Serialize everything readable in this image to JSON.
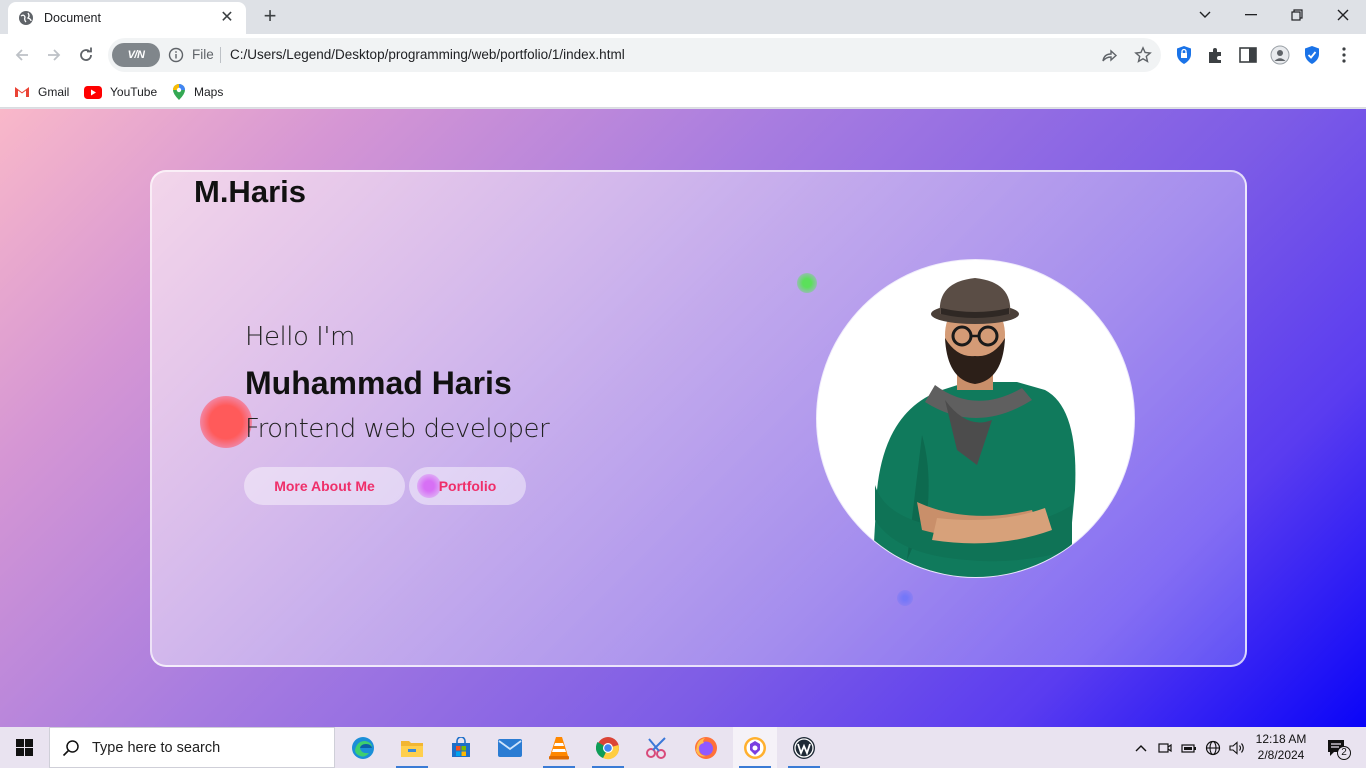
{
  "browser": {
    "tab_title": "Document",
    "close_glyph": "✕",
    "new_tab_glyph": "+",
    "address_prefix": "File",
    "url": "C:/Users/Legend/Desktop/programming/web/portfolio/1/index.html",
    "vpn_label": "V/N"
  },
  "bookmarks": [
    {
      "label": "Gmail",
      "icon": "gmail-icon"
    },
    {
      "label": "YouTube",
      "icon": "youtube-icon"
    },
    {
      "label": "Maps",
      "icon": "maps-icon"
    }
  ],
  "site": {
    "logo": "M.Haris",
    "greeting": "Hello I'm",
    "name": "Muhammad Haris",
    "role": "Frontend web developer",
    "buttons": {
      "about": "More About Me",
      "portfolio": "Portfolio"
    },
    "accent_color": "#ef2f6a"
  },
  "taskbar": {
    "search_placeholder": "Type here to search",
    "apps": [
      "edge-icon",
      "file-explorer-icon",
      "store-icon",
      "mail-icon",
      "vlc-icon",
      "chrome-icon",
      "snipping-tool-icon",
      "firefox-icon",
      "brave-icon",
      "wordpress-icon"
    ],
    "time": "12:18 AM",
    "date": "2/8/2024",
    "notification_count": "2"
  }
}
